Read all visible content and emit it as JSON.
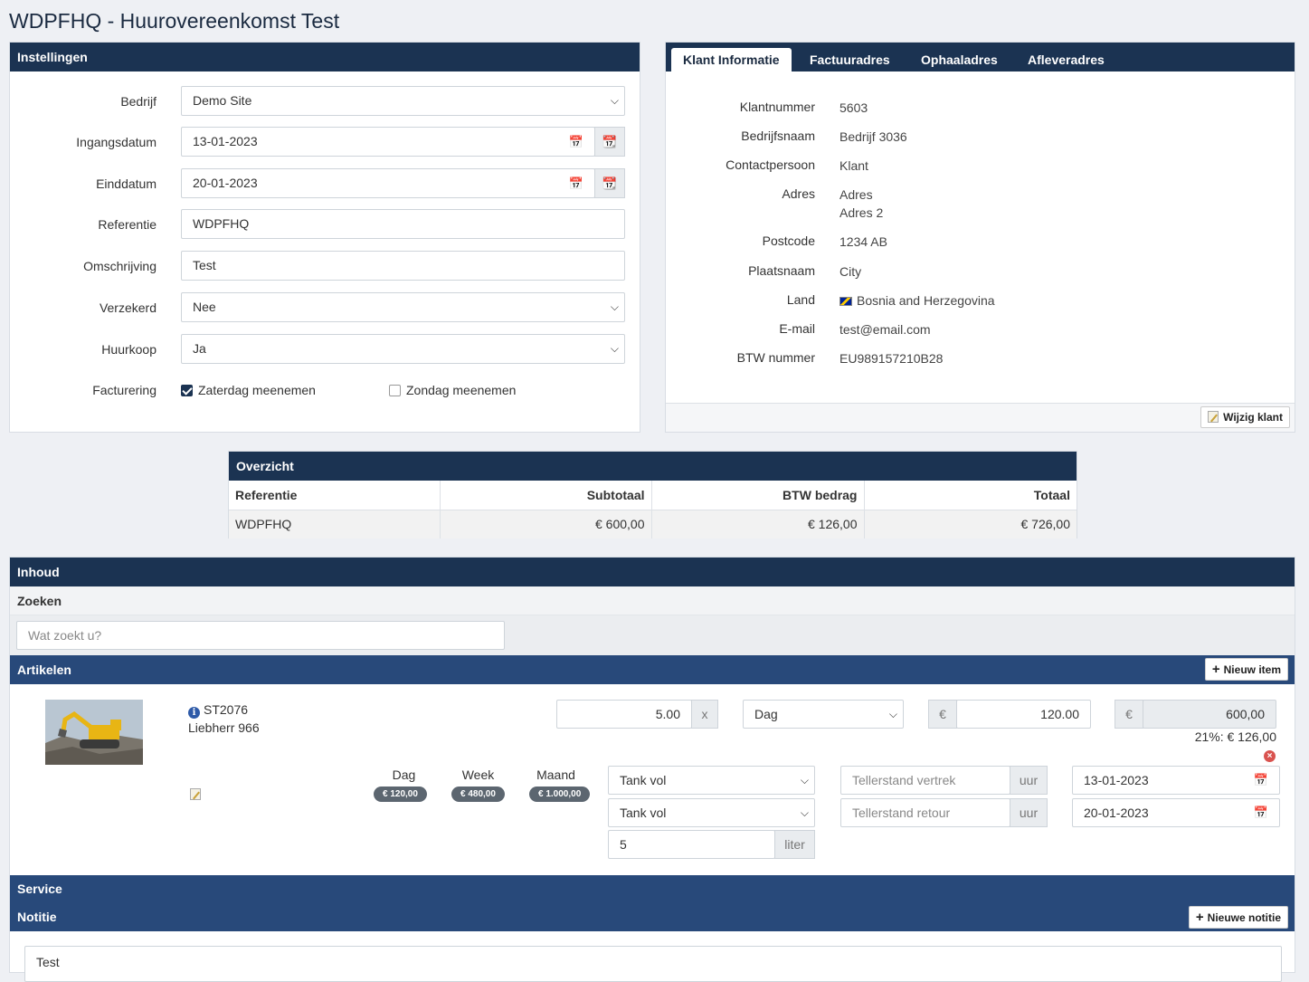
{
  "page": {
    "title": "WDPFHQ - Huurovereenkomst Test"
  },
  "settings": {
    "heading": "Instellingen",
    "company": {
      "label": "Bedrijf",
      "value": "Demo Site"
    },
    "start_date": {
      "label": "Ingangsdatum",
      "value": "13-01-2023"
    },
    "end_date": {
      "label": "Einddatum",
      "value": "20-01-2023"
    },
    "reference": {
      "label": "Referentie",
      "value": "WDPFHQ"
    },
    "description": {
      "label": "Omschrijving",
      "value": "Test"
    },
    "insured": {
      "label": "Verzekerd",
      "value": "Nee"
    },
    "hire_purchase": {
      "label": "Huurkoop",
      "value": "Ja"
    },
    "billing": {
      "label": "Facturering",
      "saturday": {
        "label": "Zaterdag meenemen",
        "checked": true
      },
      "sunday": {
        "label": "Zondag meenemen",
        "checked": false
      }
    }
  },
  "customer": {
    "tabs": [
      "Klant Informatie",
      "Factuuradres",
      "Ophaaladres",
      "Afleveradres"
    ],
    "fields": {
      "customer_number": {
        "label": "Klantnummer",
        "value": "5603"
      },
      "company_name": {
        "label": "Bedrijfsnaam",
        "value": "Bedrijf 3036"
      },
      "contact": {
        "label": "Contactpersoon",
        "value": "Klant"
      },
      "address": {
        "label": "Adres",
        "line1": "Adres",
        "line2": "Adres 2"
      },
      "postcode": {
        "label": "Postcode",
        "value": "1234 AB"
      },
      "city": {
        "label": "Plaatsnaam",
        "value": "City"
      },
      "country": {
        "label": "Land",
        "value": "Bosnia and Herzegovina"
      },
      "email": {
        "label": "E-mail",
        "value": "test@email.com"
      },
      "vat": {
        "label": "BTW nummer",
        "value": "EU989157210B28"
      }
    },
    "edit_button": "Wijzig klant"
  },
  "overview": {
    "heading": "Overzicht",
    "columns": [
      "Referentie",
      "Subtotaal",
      "BTW bedrag",
      "Totaal"
    ],
    "row": [
      "WDPFHQ",
      "€ 600,00",
      "€ 126,00",
      "€ 726,00"
    ]
  },
  "content": {
    "heading": "Inhoud",
    "search": {
      "heading": "Zoeken",
      "placeholder": "Wat zoekt u?"
    },
    "articles": {
      "heading": "Artikelen",
      "new_button": "Nieuw item",
      "item": {
        "code": "ST2076",
        "name": "Liebherr 966",
        "quantity": "5.00",
        "multiplier": "x",
        "period": "Dag",
        "currency": "€",
        "price": "120.00",
        "total": "600,00",
        "vat_line": "21%: € 126,00",
        "rates": [
          {
            "label": "Dag",
            "price": "€ 120,00"
          },
          {
            "label": "Week",
            "price": "€ 480,00"
          },
          {
            "label": "Maand",
            "price": "€ 1.000,00"
          }
        ],
        "fuel_departure": "Tank vol",
        "fuel_return": "Tank vol",
        "fuel_amount": "5",
        "fuel_unit": "liter",
        "meter_departure_placeholder": "Tellerstand vertrek",
        "meter_return_placeholder": "Tellerstand retour",
        "meter_unit": "uur",
        "date_out": "13-01-2023",
        "date_in": "20-01-2023"
      }
    },
    "service": {
      "heading": "Service"
    },
    "notes": {
      "heading": "Notitie",
      "new_button": "Nieuwe notitie",
      "text": "Test"
    }
  }
}
